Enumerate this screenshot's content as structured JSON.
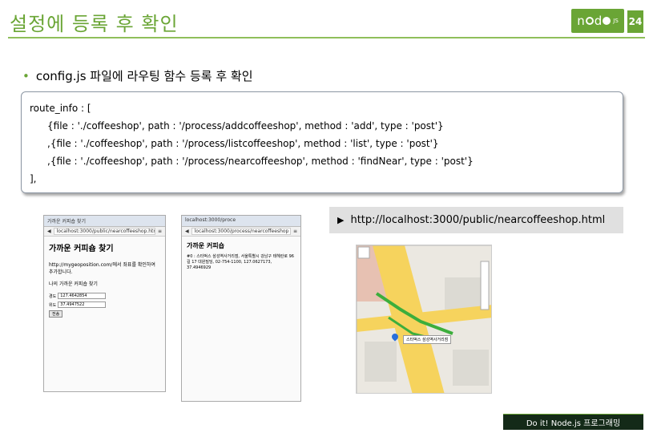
{
  "slide": {
    "title": "설정에 등록 후 확인",
    "page_number": "24",
    "logo_text": "node",
    "logo_suffix": "JS"
  },
  "bullet": {
    "text": "config.js 파일에 라우팅 함수 등록 후 확인"
  },
  "code": {
    "lines": [
      "route_info : [",
      "{file : './coffeeshop', path : '/process/addcoffeeshop', method : 'add', type : 'post'}",
      ",{file : './coffeeshop', path : '/process/listcoffeeshop', method : 'list', type : 'post'}",
      ",{file : './coffeeshop', path : '/process/nearcoffeeshop', method : 'findNear', type : 'post'}",
      "],"
    ]
  },
  "screenshot_left": {
    "tab": "가까운 커피숍 찾기",
    "url": "localhost:3000/public/nearcoffeeshop.html",
    "heading": "가까운 커피숍 찾기",
    "paragraph": "http://mygeoposition.com/에서 좌표를 확인하여 추가합니다.",
    "section": "나의 가까운 커피숍 찾기",
    "field1_label": "경도",
    "field1_value": "127.4642854",
    "field2_label": "위도",
    "field2_value": "37.4947522",
    "button": "전송"
  },
  "screenshot_right": {
    "tab": "localhost:3000/proce",
    "url": "localhost:3000/process/nearcoffeeshop",
    "heading": "가까운 커피숍",
    "item": "#0 : 스타벅스 삼성역사거리점, 서울특별시 강남구 테헤란로 96길 17 대원빌딩, 02-754-1100, 127.0627173, 37.4946929"
  },
  "url_label": {
    "arrow": "▶",
    "text": "http://localhost:3000/public/nearcoffeeshop.html"
  },
  "map": {
    "marker_label": "스타벅스 삼성역사거리점"
  },
  "footer": {
    "text": "Do it! Node.js 프로그래밍"
  },
  "colors": {
    "accent": "#6aa535",
    "footer_bg": "#142a18"
  }
}
